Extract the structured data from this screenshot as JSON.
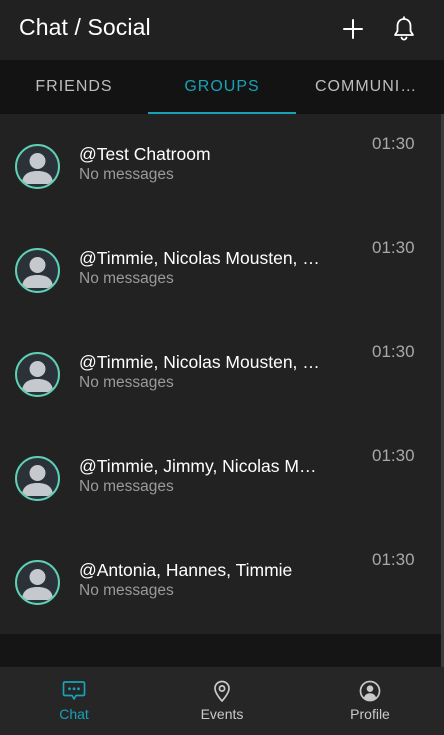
{
  "header": {
    "title": "Chat / Social",
    "add_icon": "plus-icon",
    "bell_icon": "bell-icon"
  },
  "tabs": [
    {
      "label": "FRIENDS",
      "active": false
    },
    {
      "label": "GROUPS",
      "active": true
    },
    {
      "label": "COMMUNITIES",
      "active": false
    }
  ],
  "chats": [
    {
      "name": "@Test Chatroom",
      "preview": "No messages",
      "time": "01:30"
    },
    {
      "name": "@Timmie, Nicolas Mousten, …",
      "preview": "No messages",
      "time": "01:30"
    },
    {
      "name": "@Timmie, Nicolas Mousten, …",
      "preview": "No messages",
      "time": "01:30"
    },
    {
      "name": "@Timmie, Jimmy, Nicolas M…",
      "preview": "No messages",
      "time": "01:30"
    },
    {
      "name": "@Antonia, Hannes, Timmie",
      "preview": "No messages",
      "time": "01:30"
    }
  ],
  "bottom_nav": [
    {
      "label": "Chat",
      "icon": "chat-icon",
      "active": true
    },
    {
      "label": "Events",
      "icon": "location-pin-icon",
      "active": false
    },
    {
      "label": "Profile",
      "icon": "profile-icon",
      "active": false
    }
  ],
  "colors": {
    "accent": "#17a2b8",
    "avatar_ring": "#5fd0b3",
    "background": "#222222"
  }
}
